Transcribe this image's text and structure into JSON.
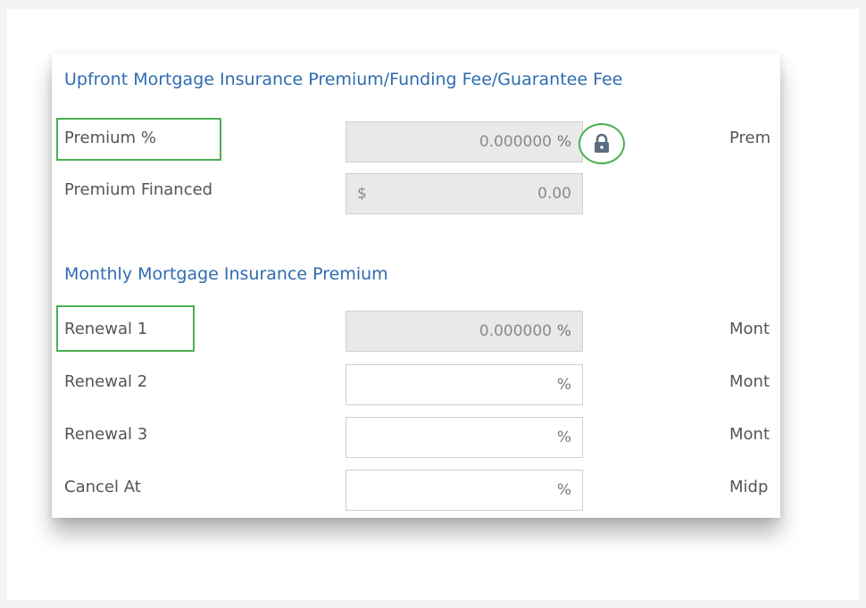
{
  "upfront": {
    "title": "Upfront Mortgage Insurance Premium/Funding Fee/Guarantee Fee",
    "premium_pct_label": "Premium %",
    "premium_pct_value": "0.000000",
    "premium_pct_suffix": "%",
    "premium_financed_label": "Premium Financed",
    "premium_financed_prefix": "$",
    "premium_financed_value": "0.00",
    "right_label": "Prem"
  },
  "monthly": {
    "title": "Monthly Mortgage Insurance Premium",
    "rows": [
      {
        "label": "Renewal 1",
        "value": "0.000000",
        "suffix": "%",
        "right_label": "Mont"
      },
      {
        "label": "Renewal 2",
        "value": "",
        "suffix": "%",
        "right_label": "Mont"
      },
      {
        "label": "Renewal 3",
        "value": "",
        "suffix": "%",
        "right_label": "Mont"
      },
      {
        "label": "Cancel At",
        "value": "",
        "suffix": "%",
        "right_label": "Midp"
      }
    ]
  },
  "colors": {
    "section_title": "#2f6cb0",
    "highlight": "#4caf50",
    "readonly_bg": "#e9e9e9"
  },
  "icons": {
    "lock": "lock-icon"
  }
}
